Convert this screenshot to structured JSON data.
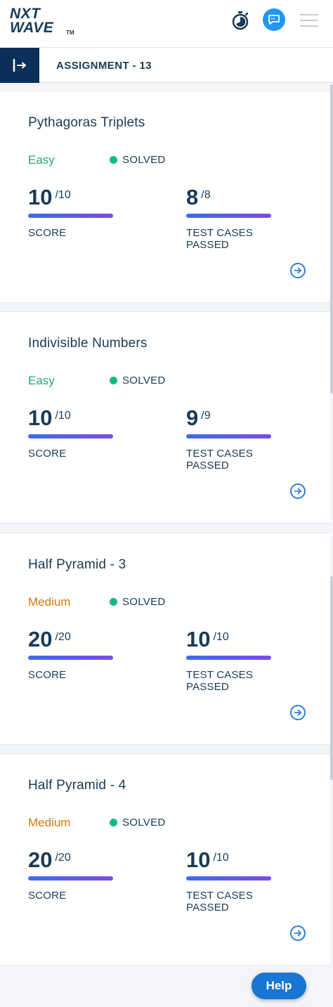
{
  "header": {
    "logo_line1": "NXT",
    "logo_line2": "WAVE",
    "logo_tm": "TM"
  },
  "subheader": {
    "title": "ASSIGNMENT - 13"
  },
  "colors": {
    "easy": "#27a96b",
    "medium": "#d97706",
    "solved_dot": "#10b981",
    "primary": "#183b56",
    "accent": "#2196f3"
  },
  "problems": [
    {
      "title": "Pythagoras Triplets",
      "difficulty": "Easy",
      "status": "SOLVED",
      "score": "10",
      "score_max": "/10",
      "score_label": "SCORE",
      "tests": "8",
      "tests_max": "/8",
      "tests_label": "TEST CASES PASSED"
    },
    {
      "title": "Indivisible Numbers",
      "difficulty": "Easy",
      "status": "SOLVED",
      "score": "10",
      "score_max": "/10",
      "score_label": "SCORE",
      "tests": "9",
      "tests_max": "/9",
      "tests_label": "TEST CASES PASSED"
    },
    {
      "title": "Half Pyramid - 3",
      "difficulty": "Medium",
      "status": "SOLVED",
      "score": "20",
      "score_max": "/20",
      "score_label": "SCORE",
      "tests": "10",
      "tests_max": "/10",
      "tests_label": "TEST CASES PASSED"
    },
    {
      "title": "Half Pyramid - 4",
      "difficulty": "Medium",
      "status": "SOLVED",
      "score": "20",
      "score_max": "/20",
      "score_label": "SCORE",
      "tests": "10",
      "tests_max": "/10",
      "tests_label": "TEST CASES PASSED"
    }
  ],
  "help": {
    "label": "Help"
  }
}
